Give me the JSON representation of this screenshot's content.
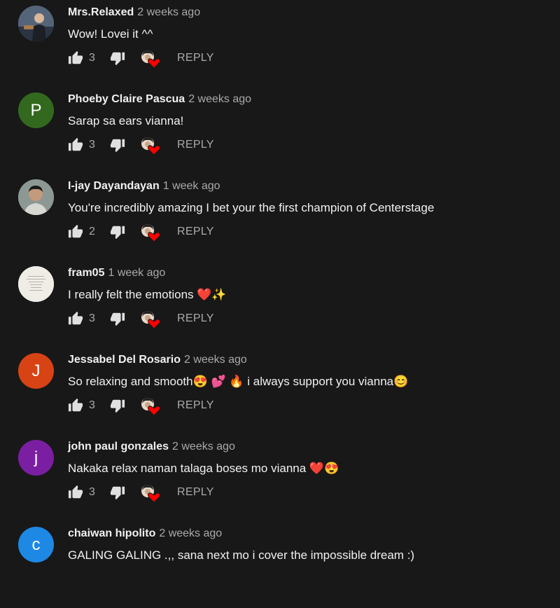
{
  "comments": [
    {
      "author": "Mrs.Relaxed",
      "time": "2 weeks ago",
      "text": "Wow! Lovei it ^^",
      "likes": "3",
      "avatar": {
        "type": "photo",
        "letter": "",
        "color": "#3a4a5e"
      },
      "reply_label": "REPLY"
    },
    {
      "author": "Phoeby Claire Pascua",
      "time": "2 weeks ago",
      "text": "Sarap sa ears vianna!",
      "likes": "3",
      "avatar": {
        "type": "letter",
        "letter": "P",
        "color": "#33691e"
      },
      "reply_label": "REPLY"
    },
    {
      "author": "I-jay Dayandayan",
      "time": "1 week ago",
      "text": "You're incredibly amazing I bet your the first champion of Centerstage",
      "likes": "2",
      "avatar": {
        "type": "photo",
        "letter": "",
        "color": "#7d8a86"
      },
      "reply_label": "REPLY"
    },
    {
      "author": "fram05",
      "time": "1 week ago",
      "text": "I really felt the emotions ❤️✨",
      "likes": "3",
      "avatar": {
        "type": "photo",
        "letter": "",
        "color": "#efece6"
      },
      "reply_label": "REPLY"
    },
    {
      "author": "Jessabel Del Rosario",
      "time": "2 weeks ago",
      "text": "So relaxing and smooth😍 💕  🔥  i always support you vianna😊",
      "likes": "3",
      "avatar": {
        "type": "letter",
        "letter": "J",
        "color": "#d84315"
      },
      "reply_label": "REPLY"
    },
    {
      "author": "john paul gonzales",
      "time": "2 weeks ago",
      "text": "Nakaka relax naman talaga boses mo vianna ❤️😍",
      "likes": "3",
      "avatar": {
        "type": "letter",
        "letter": "j",
        "color": "#7b1fa2"
      },
      "reply_label": "REPLY"
    },
    {
      "author": "chaiwan hipolito",
      "time": "2 weeks ago",
      "text": "GALING GALING .,, sana next mo i cover the impossible dream :)",
      "likes": "",
      "avatar": {
        "type": "letter",
        "letter": "c",
        "color": "#1e88e5"
      },
      "reply_label": ""
    }
  ],
  "icons": {
    "like": "thumbs-up-icon",
    "dislike": "thumbs-down-icon",
    "creator_heart": "creator-heart-icon"
  },
  "colors": {
    "background": "#181818",
    "primary_text": "#f1f1f1",
    "secondary_text": "#aaaaaa",
    "heart": "#ff0000"
  }
}
